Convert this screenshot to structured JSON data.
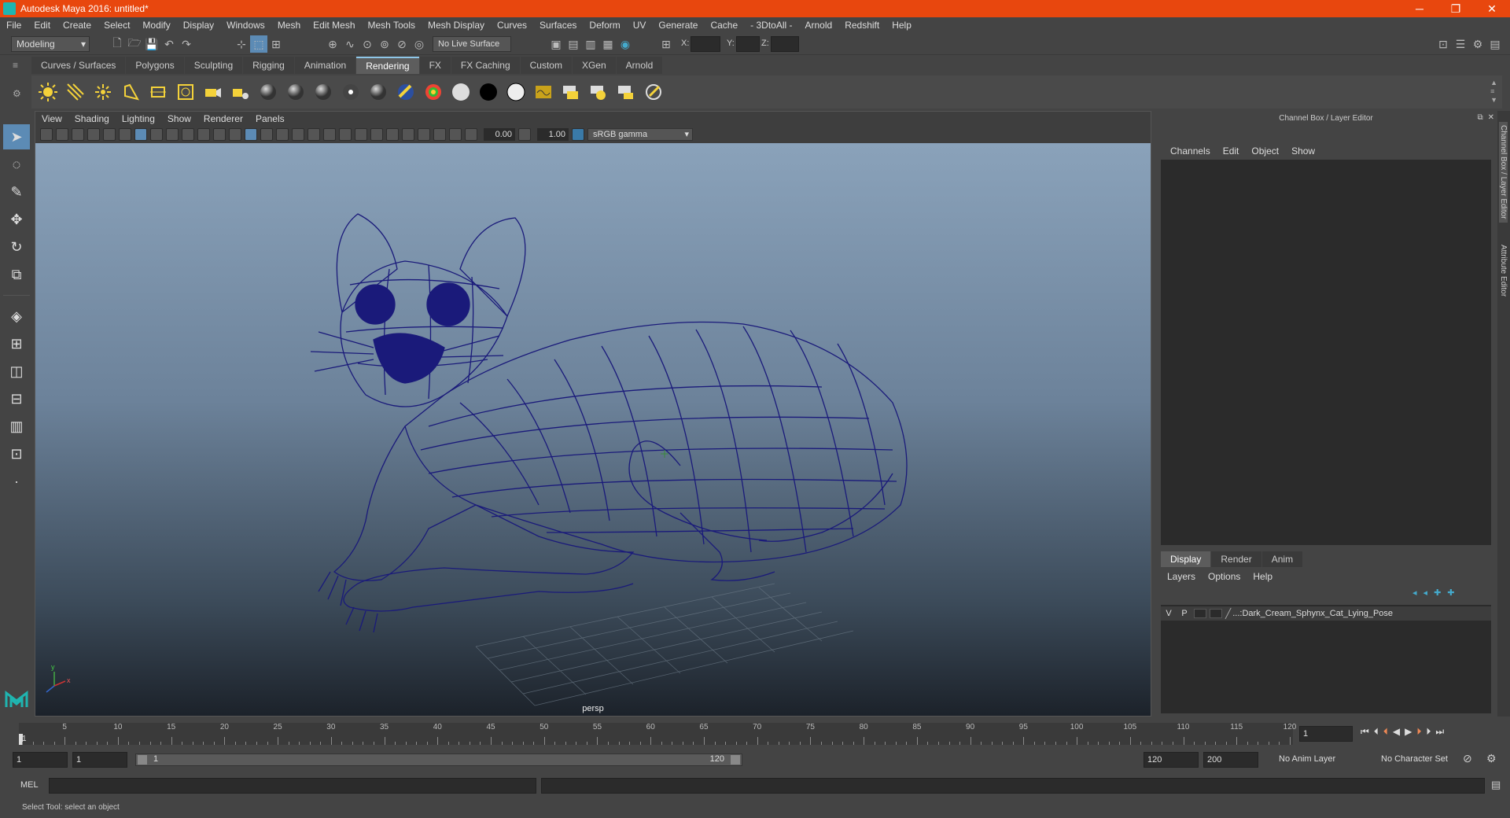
{
  "window": {
    "title": "Autodesk Maya 2016: untitled*",
    "minimize": "─",
    "maximize": "❐",
    "close": "✕"
  },
  "menubar": [
    "File",
    "Edit",
    "Create",
    "Select",
    "Modify",
    "Display",
    "Windows",
    "Mesh",
    "Edit Mesh",
    "Mesh Tools",
    "Mesh Display",
    "Curves",
    "Surfaces",
    "Deform",
    "UV",
    "Generate",
    "Cache",
    "- 3DtoAll -",
    "Arnold",
    "Redshift",
    "Help"
  ],
  "statusline": {
    "mode": "Modeling",
    "live_surface": "No Live Surface",
    "x_label": "X:",
    "y_label": "Y:",
    "z_label": "Z:"
  },
  "shelf_tabs": [
    {
      "label": "Curves / Surfaces",
      "active": false
    },
    {
      "label": "Polygons",
      "active": false
    },
    {
      "label": "Sculpting",
      "active": false
    },
    {
      "label": "Rigging",
      "active": false
    },
    {
      "label": "Animation",
      "active": false
    },
    {
      "label": "Rendering",
      "active": true
    },
    {
      "label": "FX",
      "active": false
    },
    {
      "label": "FX Caching",
      "active": false
    },
    {
      "label": "Custom",
      "active": false
    },
    {
      "label": "XGen",
      "active": false
    },
    {
      "label": "Arnold",
      "active": false
    }
  ],
  "shelf_icons": [
    "ambient-light-icon",
    "directional-light-icon",
    "point-light-icon",
    "spot-light-icon",
    "area-light-icon",
    "volume-light-icon",
    "camera-icon",
    "camera-aim-icon",
    "lambert-sphere-icon",
    "blinn-sphere-icon",
    "phong-sphere-icon",
    "anisotropic-sphere-icon",
    "shading-sphere-icon",
    "surface-shader-icon",
    "ramp-shader-icon",
    "white-material-icon",
    "black-material-icon",
    "layered-shader-icon",
    "render-view-icon",
    "render-settings-icon",
    "ipr-render-icon",
    "batch-render-icon",
    "hypershade-icon"
  ],
  "viewport": {
    "menu": [
      "View",
      "Shading",
      "Lighting",
      "Show",
      "Renderer",
      "Panels"
    ],
    "exposure": "0.00",
    "gamma": "1.00",
    "color_space": "sRGB gamma",
    "camera_label": "persp",
    "axis_y": "y",
    "axis_x": "x"
  },
  "right_panel": {
    "header": "Channel Box / Layer Editor",
    "menu": [
      "Channels",
      "Edit",
      "Object",
      "Show"
    ],
    "layer_tabs": [
      {
        "label": "Display",
        "active": true
      },
      {
        "label": "Render",
        "active": false
      },
      {
        "label": "Anim",
        "active": false
      }
    ],
    "layer_menu": [
      "Layers",
      "Options",
      "Help"
    ],
    "layer": {
      "v": "V",
      "p": "P",
      "name": "...:Dark_Cream_Sphynx_Cat_Lying_Pose"
    },
    "side_tabs": [
      "Channel Box / Layer Editor",
      "Attribute Editor"
    ]
  },
  "timeline": {
    "labels": [
      "5",
      "10",
      "15",
      "20",
      "25",
      "30",
      "35",
      "40",
      "45",
      "50",
      "55",
      "60",
      "65",
      "70",
      "75",
      "80",
      "85",
      "90",
      "95",
      "100",
      "105",
      "110",
      "115",
      "120"
    ],
    "start_marker": "1",
    "current_frame": "1"
  },
  "range": {
    "start": "1",
    "playback_start": "1",
    "slider_start": "1",
    "slider_end": "120",
    "playback_end": "120",
    "end": "200",
    "anim_layer": "No Anim Layer",
    "char_set": "No Character Set"
  },
  "command": {
    "label": "MEL"
  },
  "help": {
    "text": "Select Tool: select an object"
  },
  "colors": {
    "title_bar": "#e8470e",
    "wireframe": "#1a1a7a",
    "active_tab": "#8ec6e8"
  }
}
